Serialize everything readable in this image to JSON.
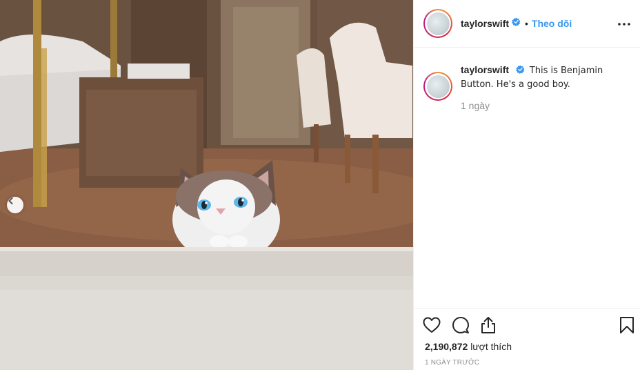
{
  "header": {
    "username": "taylorswift",
    "separator": "•",
    "follow_label": "Theo dõi",
    "avatar_icon": "avatar-icon",
    "verified_icon": "verified-badge-icon",
    "more_icon": "more-options-icon"
  },
  "comment": {
    "username": "taylorswift",
    "text": "This is Benjamin Button. He's a good boy.",
    "time": "1 ngày"
  },
  "actions": {
    "like_icon": "heart-icon",
    "comment_icon": "comment-icon",
    "share_icon": "share-icon",
    "save_icon": "bookmark-icon"
  },
  "likes": {
    "count": "2,190,872",
    "label": "lượt thích"
  },
  "timestamp": "1 NGÀY TRƯỚC",
  "photo": {
    "prev_icon": "chevron-left-icon"
  },
  "colors": {
    "accent": "#3897f0",
    "text": "#262626",
    "muted": "#8e8e8e",
    "border": "#efefef"
  }
}
